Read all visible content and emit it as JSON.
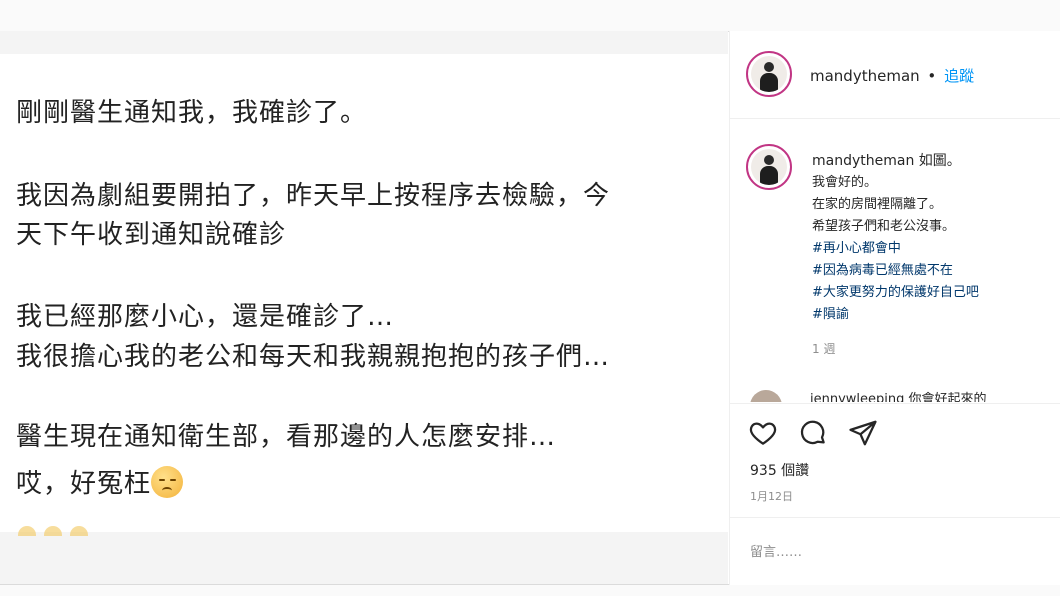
{
  "photo": {
    "lines": [
      "剛剛醫生通知我，我確診了。",
      "我因為劇組要開拍了，昨天早上按程序去檢驗，今",
      "天下午收到通知說確診",
      "我已經那麼小心，還是確診了…",
      "我很擔心我的老公和每天和我親親抱抱的孩子們…",
      "醫生現在通知衛生部，看那邊的人怎麼安排…",
      "哎，好冤枉"
    ],
    "emoji_icon": "disappointed-face-emoji"
  },
  "header": {
    "username": "mandytheman",
    "separator": "•",
    "follow_label": "追蹤"
  },
  "caption": {
    "username": "mandytheman",
    "first_line": "如圖。",
    "lines": [
      "我會好的。",
      "在家的房間裡隔離了。",
      "希望孩子們和老公沒事。"
    ],
    "hashtags": [
      "#再小心都會中",
      "#因為病毒已經無處不在",
      "#大家更努力的保護好自己吧",
      "#隕諭"
    ],
    "time": "1 週"
  },
  "next_comment": {
    "text": "jennywleeping 你會好起來的"
  },
  "actions": {
    "like_icon": "heart-icon",
    "comment_icon": "comment-bubble-icon",
    "share_icon": "paper-plane-icon",
    "likes_text": "935 個讚",
    "date_text": "1月12日"
  },
  "comment_box": {
    "placeholder": "留言……"
  }
}
